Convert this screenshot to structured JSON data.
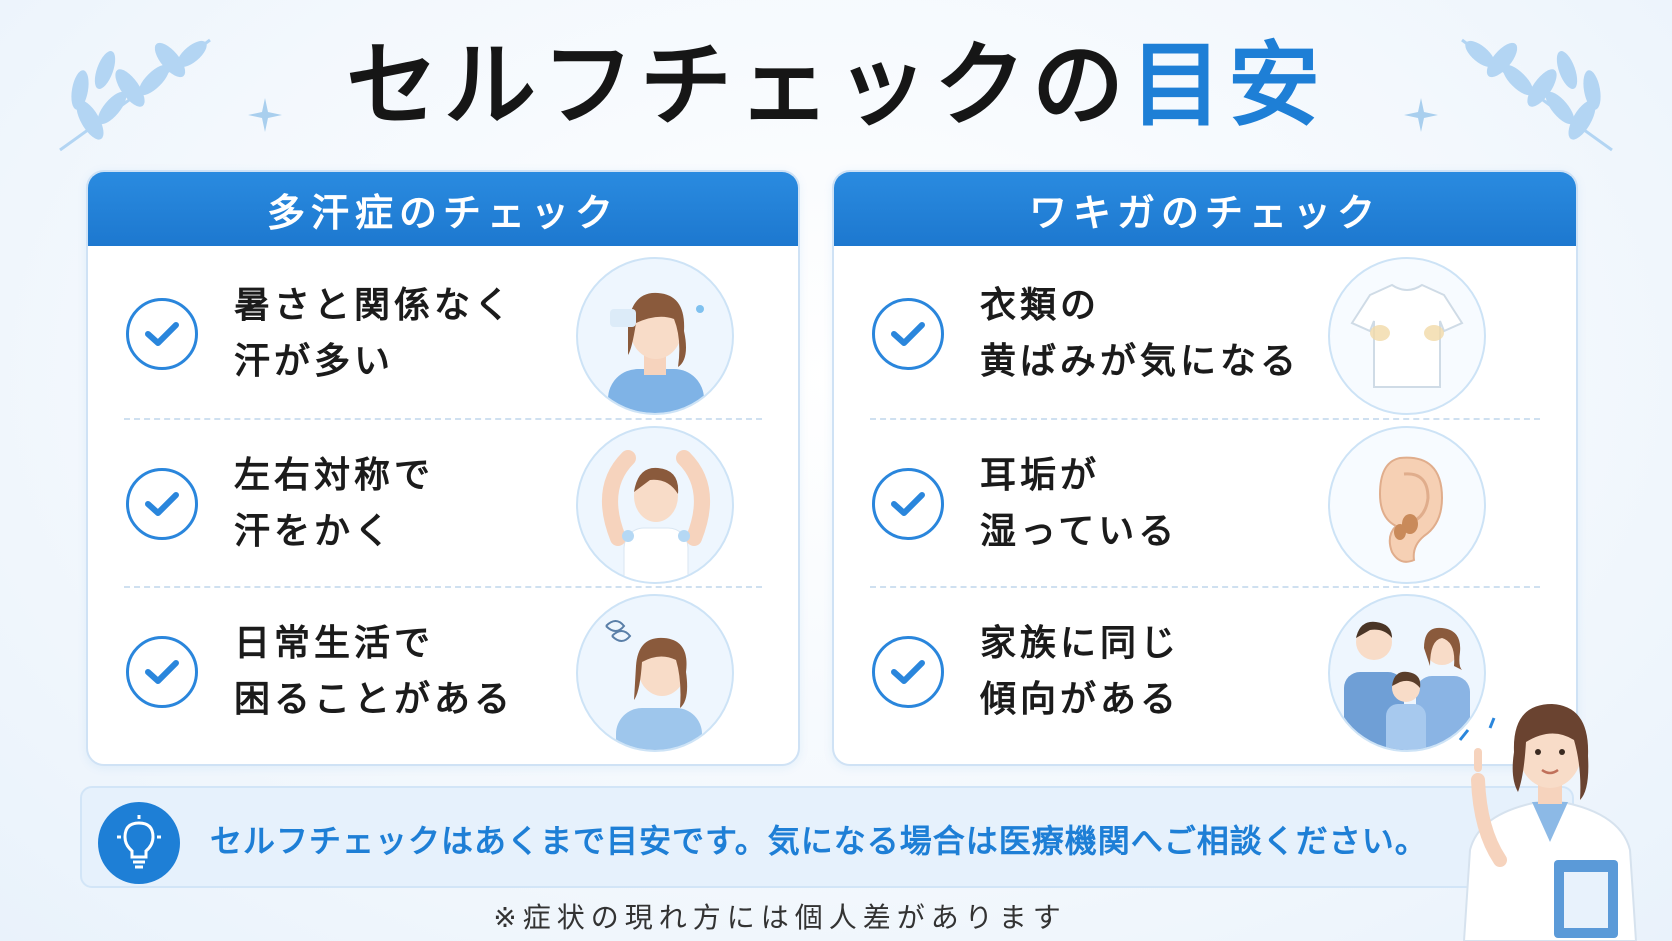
{
  "title": {
    "main": "セルフチェックの",
    "accent": "目安"
  },
  "panels": [
    {
      "header": "多汗症のチェック",
      "items": [
        {
          "line1": "暑さと関係なく",
          "line2": "汗が多い",
          "image": "woman-wiping-sweat"
        },
        {
          "line1": "左右対称で",
          "line2": "汗をかく",
          "image": "woman-armpit-sweat"
        },
        {
          "line1": "日常生活で",
          "line2": "困ることがある",
          "image": "woman-troubled"
        }
      ]
    },
    {
      "header": "ワキガのチェック",
      "items": [
        {
          "line1": "衣類の",
          "line2": "黄ばみが気になる",
          "image": "tshirt-stains"
        },
        {
          "line1": "耳垢が",
          "line2": "湿っている",
          "image": "ear-wet-earwax"
        },
        {
          "line1": "家族に同じ",
          "line2": "傾向がある",
          "image": "family"
        }
      ]
    }
  ],
  "notice": {
    "icon": "lightbulb-icon",
    "text": "セルフチェックはあくまで目安です。気になる場合は医療機関へご相談ください。"
  },
  "footnote": "※症状の現れ方には個人差があります",
  "colors": {
    "accent": "#1e7fd6",
    "header": "#2a8be0",
    "background": "#f2f7fc"
  }
}
